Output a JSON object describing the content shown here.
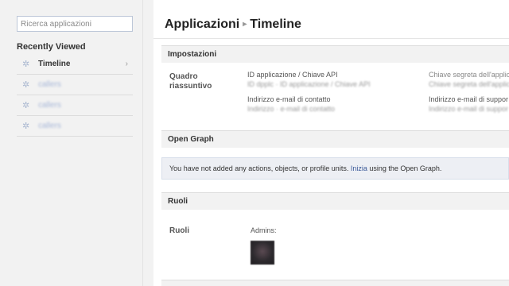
{
  "sidebar": {
    "search_placeholder": "Ricerca applicazioni",
    "heading": "Recently Viewed",
    "items": [
      {
        "label": "Timeline",
        "icon": "gear-icon"
      },
      {
        "label": "callers",
        "icon": "gear-icon"
      },
      {
        "label": "callers",
        "icon": "gear-icon"
      },
      {
        "label": "callers",
        "icon": "gear-icon"
      }
    ]
  },
  "breadcrumb": {
    "parent": "Applicazioni",
    "separator": "▸",
    "current": "Timeline"
  },
  "settings": {
    "title": "Impostazioni",
    "summary_label": "Quadro riassuntivo",
    "app_id_title": "ID applicazione / Chiave API",
    "app_id_value": "ID dpplc · ID applicazione / Chiave API",
    "secret_title": "Chiave segreta dell'applic",
    "secret_value": "Chiave segreta dell'applic",
    "contact_email_title": "Indirizzo e-mail di contatto",
    "contact_email_value": "Indirizzo · e-mail di contatto",
    "support_email_title": "Indirizzo e-mail di suppor",
    "support_email_value": "Indirizzo e-mail di suppor"
  },
  "open_graph": {
    "title": "Open Graph",
    "message_before": "You have not added any actions, objects, or profile units.",
    "link_text": "Inizia",
    "message_after": "using the Open Graph."
  },
  "roles": {
    "title": "Ruoli",
    "label": "Ruoli",
    "admins_label": "Admins:"
  },
  "colors": {
    "link": "#3b5998",
    "info_bg": "#edeff4"
  }
}
